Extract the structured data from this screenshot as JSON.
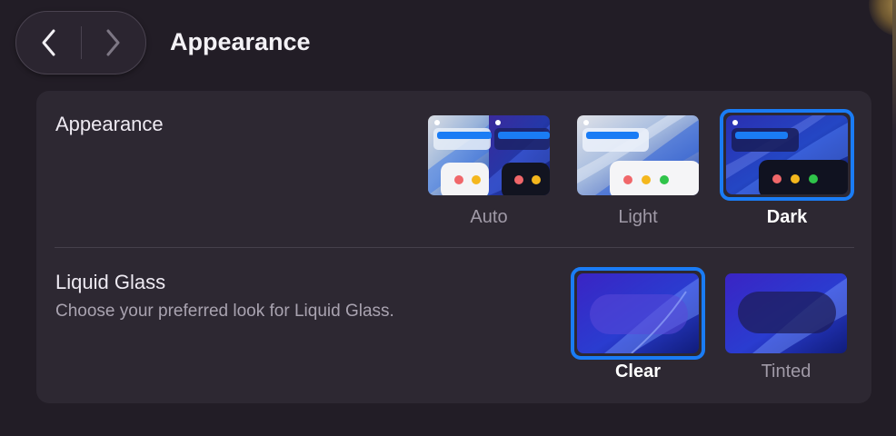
{
  "header": {
    "back_icon": "chevron-left-icon",
    "forward_icon": "chevron-right-icon",
    "title": "Appearance"
  },
  "appearance": {
    "label": "Appearance",
    "options": [
      {
        "label": "Auto",
        "selected": false
      },
      {
        "label": "Light",
        "selected": false
      },
      {
        "label": "Dark",
        "selected": true
      }
    ]
  },
  "liquid_glass": {
    "label": "Liquid Glass",
    "description": "Choose your preferred look for Liquid Glass.",
    "options": [
      {
        "label": "Clear",
        "selected": true
      },
      {
        "label": "Tinted",
        "selected": false
      }
    ]
  },
  "colors": {
    "accent": "#1a7cf5",
    "window_bg": "#221d26",
    "card_bg": "#2d2832",
    "traffic_red": "#f0676a",
    "traffic_yellow": "#f4b71d",
    "traffic_green": "#2fc44a"
  }
}
